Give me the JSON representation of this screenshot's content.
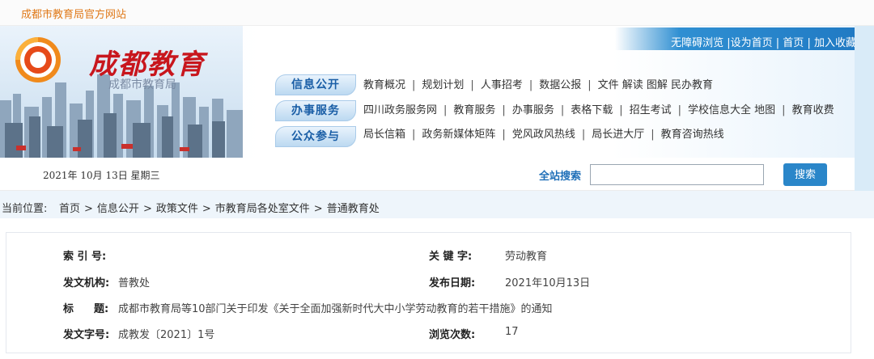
{
  "top_site_name": "成都市教育局官方网站",
  "header": {
    "logo_title": "成都教育",
    "logo_subtitle": "成都市教育局",
    "utility_links": [
      "无障碍浏览",
      "设为首页",
      "首页",
      "加入收藏"
    ]
  },
  "nav": {
    "categories": [
      "信息公开",
      "办事服务",
      "公众参与"
    ],
    "row1": [
      "教育概况",
      "规划计划",
      "人事招考",
      "数据公报",
      "文件 解读 图解 民办教育"
    ],
    "row2": [
      "四川政务服务网",
      "教育服务",
      "办事服务",
      "表格下载",
      "招生考试",
      "学校信息大全 地图",
      "教育收费"
    ],
    "row3": [
      "局长信箱",
      "政务新媒体矩阵",
      "党风政风热线",
      "局长进大厅",
      "教育咨询热线"
    ]
  },
  "datebar": {
    "date_text": "2021年 10月 13日 星期三",
    "search_label": "全站搜索",
    "search_value": "",
    "search_button": "搜索"
  },
  "breadcrumb": {
    "label": "当前位置:",
    "items": [
      "首页",
      "信息公开",
      "政策文件",
      "市教育局各处室文件",
      "普通教育处"
    ]
  },
  "document_info": {
    "index_label": "索 引 号:",
    "index_value": "",
    "keyword_label": "关 键 字:",
    "keyword_value": "劳动教育",
    "issuer_label": "发文机构:",
    "issuer_value": "普教处",
    "date_label": "发布日期:",
    "date_value": "2021年10月13日",
    "title_label_a": "标",
    "title_label_b": "题:",
    "title_value": "成都市教育局等10部门关于印发《关于全面加强新时代大中小学劳动教育的若干措施》的通知",
    "docno_label": "发文字号:",
    "docno_value": "成教发〔2021〕1号",
    "views_label": "浏览次数:",
    "views_value": "17"
  },
  "colors": {
    "site_orange": "#e07a1a",
    "logo_red": "#c8161d",
    "primary_blue": "#2a86c9",
    "nav_blue": "#1a5ea6"
  }
}
